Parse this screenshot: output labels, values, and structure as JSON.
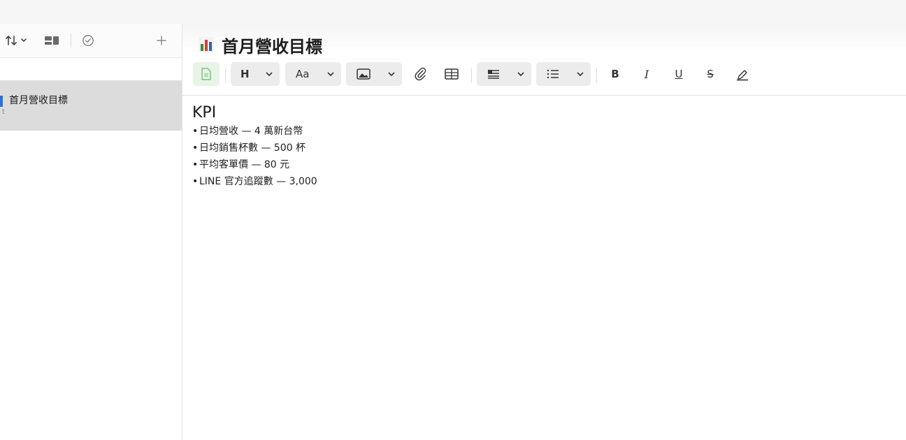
{
  "sidebar": {
    "toolbar": {
      "sort_icon": "sort-arrows-icon",
      "view_icon": "gallery-view-icon",
      "check_icon": "checkmark-circle-icon",
      "add_icon": "plus-icon"
    },
    "notes": [
      {
        "title": "首月營收目標",
        "subtitle": "t",
        "accent": "#2f6fd6"
      }
    ]
  },
  "note": {
    "title": "首月營收目標",
    "title_icon": "bar-chart-icon",
    "content": {
      "heading": "KPI",
      "bullets": [
        "日均營收 — 4 萬新台幣",
        "日均銷售杯數 — 500 杯",
        "平均客單價 — 80 元",
        "LINE 官方追蹤數 — 3,000"
      ]
    }
  },
  "toolbar": {
    "heading_label": "H",
    "font_label": "Aa",
    "bold_label": "B",
    "italic_label": "I",
    "underline_label": "U",
    "strike_label": "S"
  },
  "colors": {
    "accent": "#2f6fd6",
    "selected_bg": "#dcdcdc",
    "page_icon_green": "#7cc47f"
  }
}
